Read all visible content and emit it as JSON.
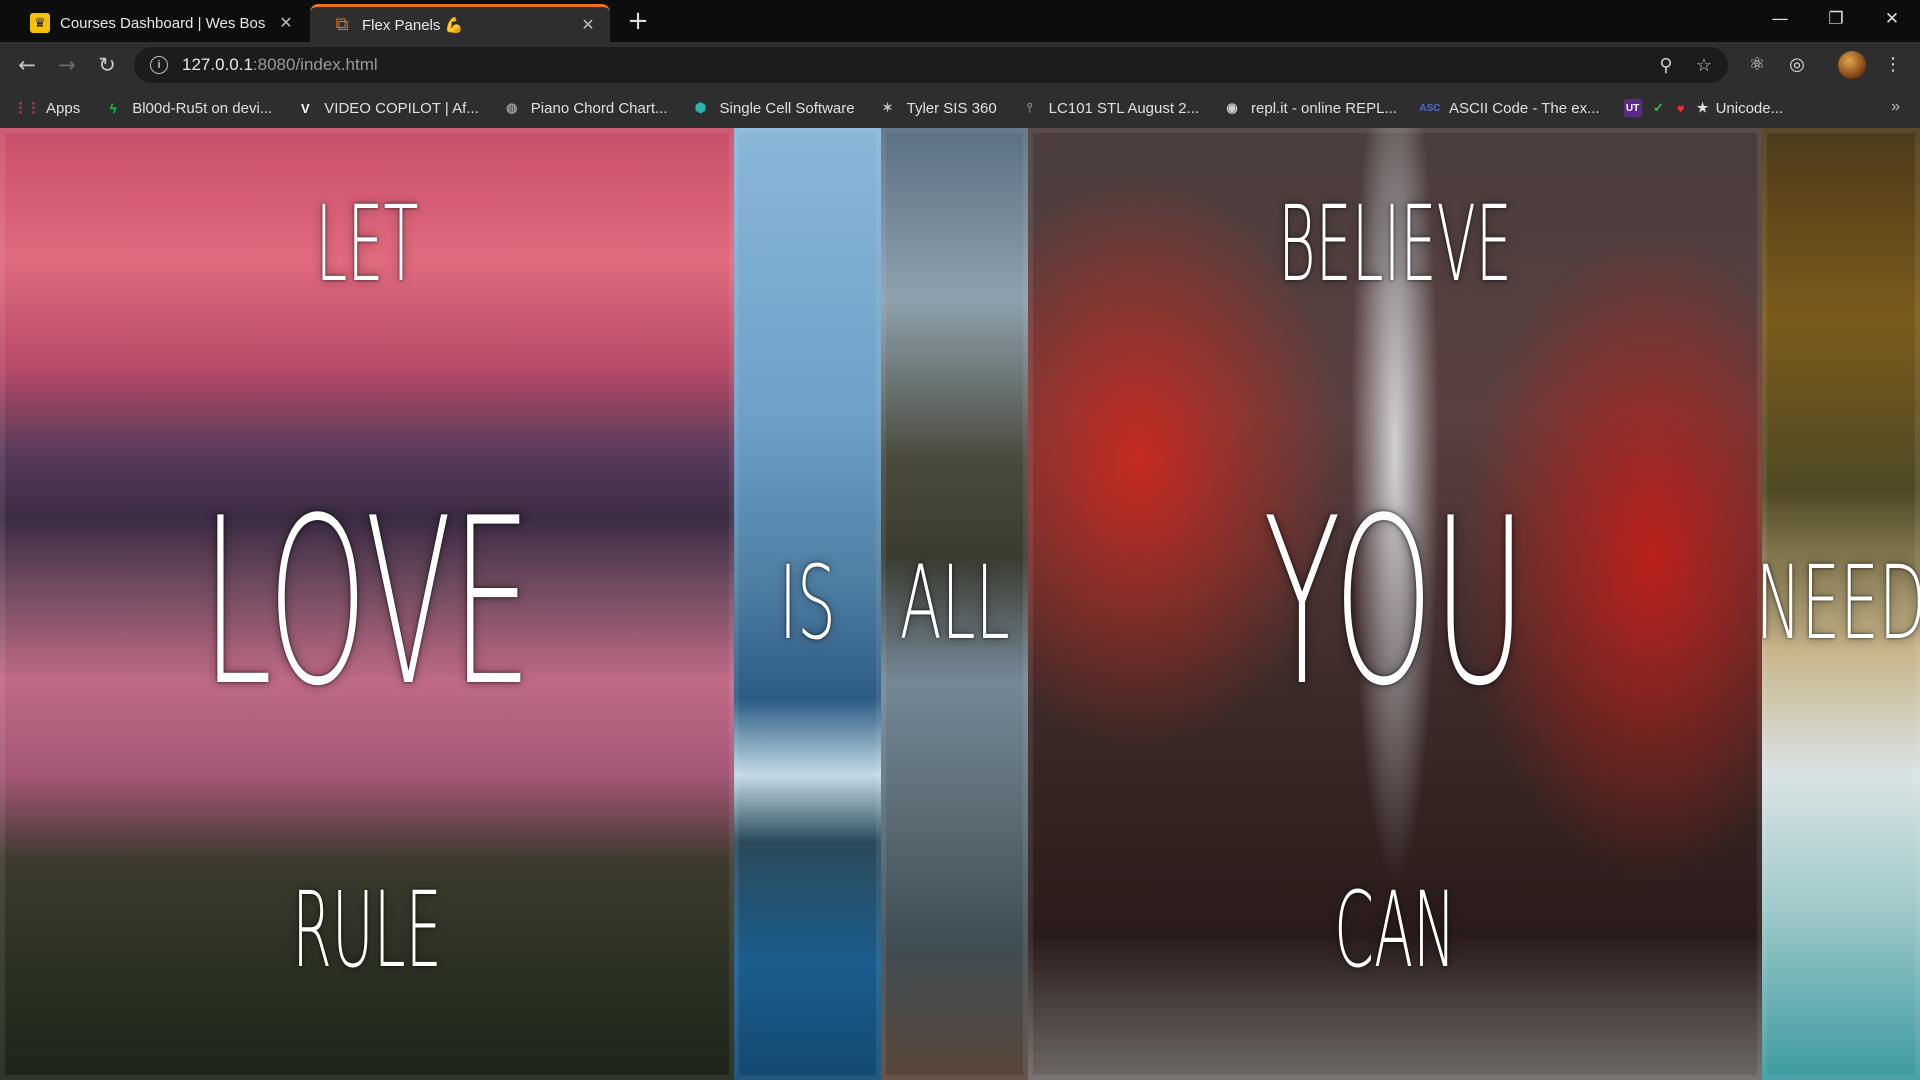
{
  "browser": {
    "tabs": [
      {
        "title": "Courses Dashboard | Wes Bos",
        "favicon": "wesbos-crown-icon",
        "active": false
      },
      {
        "title": "Flex Panels 💪",
        "favicon": "flex-panels-icon",
        "active": true
      }
    ],
    "address_bar": {
      "url_host": "127.0.0.1",
      "url_rest": ":8080/index.html"
    },
    "bookmarks": [
      {
        "label": "Apps",
        "icon": "apps-grid-icon",
        "color": "#e8453c"
      },
      {
        "label": "Bl00d-Ru5t on devi...",
        "icon": "deviantart-icon",
        "color": "#05cc47"
      },
      {
        "label": "VIDEO COPILOT | Af...",
        "icon": "videocopilot-icon",
        "color": "#ffffff"
      },
      {
        "label": "Piano Chord Chart...",
        "icon": "globe-icon",
        "color": "#9a9a9a"
      },
      {
        "label": "Single Cell Software",
        "icon": "cube-icon",
        "color": "#2bb4b4"
      },
      {
        "label": "Tyler SIS 360",
        "icon": "tyler-icon",
        "color": "#bbbbbb"
      },
      {
        "label": "LC101 STL August 2...",
        "icon": "launchcode-icon",
        "color": "#7f8fa6"
      },
      {
        "label": "repl.it - online REPL...",
        "icon": "replit-icon",
        "color": "#cfcfcf"
      },
      {
        "label": "ASCII Code - The ex...",
        "icon": "ascii-icon",
        "color": "#4a6cd4"
      },
      {
        "label": "Unicode...",
        "icon": "unicode-icon",
        "color": "#ff2b2b"
      }
    ]
  },
  "panels": [
    {
      "top": "Let",
      "middle": "Love",
      "bottom": "Rule",
      "scene": "pink sunset mountains over lake"
    },
    {
      "top": "",
      "middle": "Is",
      "bottom": "",
      "scene": "blue misty river with snow"
    },
    {
      "top": "",
      "middle": "All",
      "bottom": "",
      "scene": "rocky waterfall rapids"
    },
    {
      "top": "Believe",
      "middle": "You",
      "bottom": "Can",
      "scene": "waterfall with red autumn trees and bridge"
    },
    {
      "top": "",
      "middle": "Need",
      "bottom": "",
      "scene": "autumn forest waterfall with turquoise pool"
    }
  ]
}
